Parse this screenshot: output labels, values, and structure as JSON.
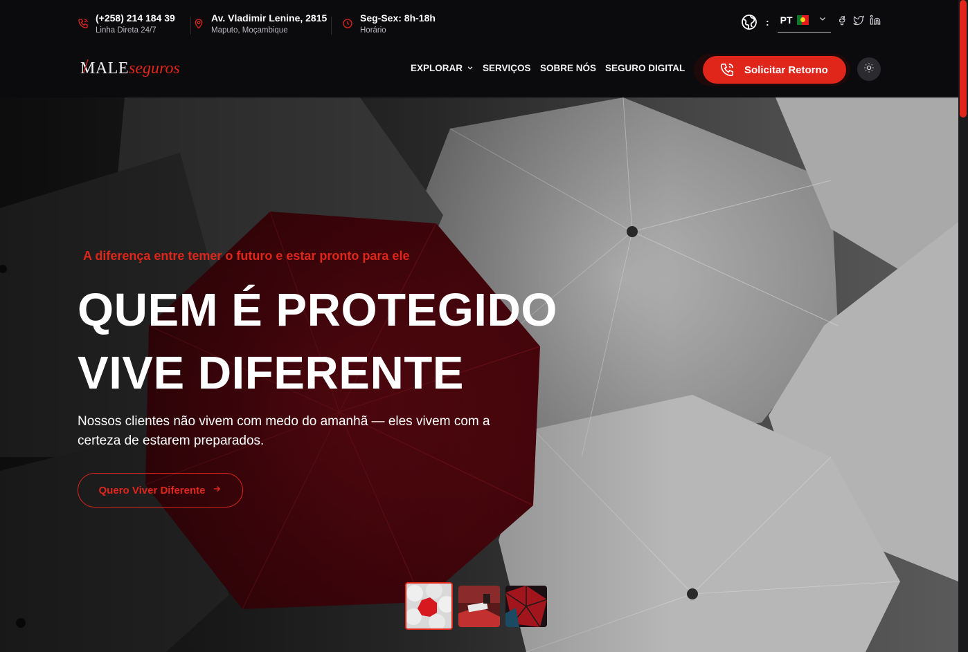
{
  "topbar": {
    "phone": {
      "main": "(+258) 214 184 39",
      "sub": "Linha Direta 24/7",
      "icon": "phone-icon"
    },
    "address": {
      "main": "Av. Vladimir Lenine, 2815",
      "sub": "Maputo, Moçambique",
      "icon": "location-pin-icon"
    },
    "hours": {
      "main": "Seg-Sex: 8h-18h",
      "sub": "Horário",
      "icon": "clock-icon"
    },
    "language": {
      "colon": ":",
      "code": "PT"
    }
  },
  "navbar": {
    "logo": {
      "part1": "MALE",
      "part2": "seguros",
      "slash": "/"
    },
    "items": [
      {
        "label": "EXPLORAR"
      },
      {
        "label": "SERVIÇOS"
      },
      {
        "label": "SOBRE NÓS"
      },
      {
        "label": "SEGURO DIGITAL"
      }
    ],
    "cta_label": "Solicitar Retorno"
  },
  "hero": {
    "tagline": "A diferença entre temer o futuro e estar pronto para ele",
    "headline_line1": "QUEM É PROTEGIDO",
    "headline_line2": "VIVE DIFERENTE",
    "description": "Nossos clientes não vivem com medo do amanhã — eles vivem com a certeza de estarem preparados.",
    "button_label": "Quero Viver Diferente"
  },
  "colors": {
    "accent": "#e0251b",
    "background": "#0b0b0e",
    "umbrella_red": "#7a0d17"
  }
}
